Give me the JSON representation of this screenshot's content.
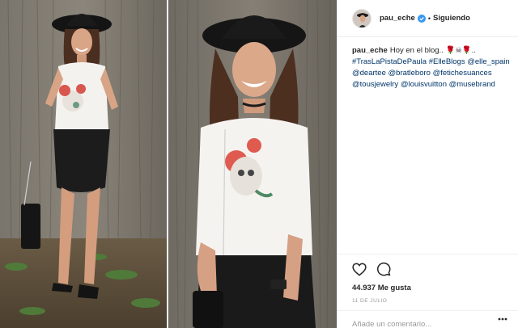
{
  "post": {
    "username": "pau_eche",
    "follow_separator": "•",
    "follow_label": "Siguiendo",
    "caption": {
      "text": "Hoy en el blog.. ",
      "emojis": "🌹☠🌹..",
      "tags": [
        "#TrasLaPistaDePaula",
        "#ElleBlogs",
        "@elle_spain",
        "@deartee",
        "@bratleboro",
        "@fetichesuances",
        "@tousjewelry",
        "@louisvuitton",
        "@musebrand"
      ]
    },
    "likes": "44.937 Me gusta",
    "date": "11 DE JULIO",
    "comment_placeholder": "Añade un comentario..."
  },
  "icons": {
    "like": "heart-outline-icon",
    "comment": "comment-bubble-icon",
    "verified": "verified-badge-icon",
    "more": "more-options-icon"
  },
  "colors": {
    "text": "#262626",
    "link": "#003569",
    "muted": "#999999",
    "border": "#efefef",
    "verified": "#3897f0"
  }
}
